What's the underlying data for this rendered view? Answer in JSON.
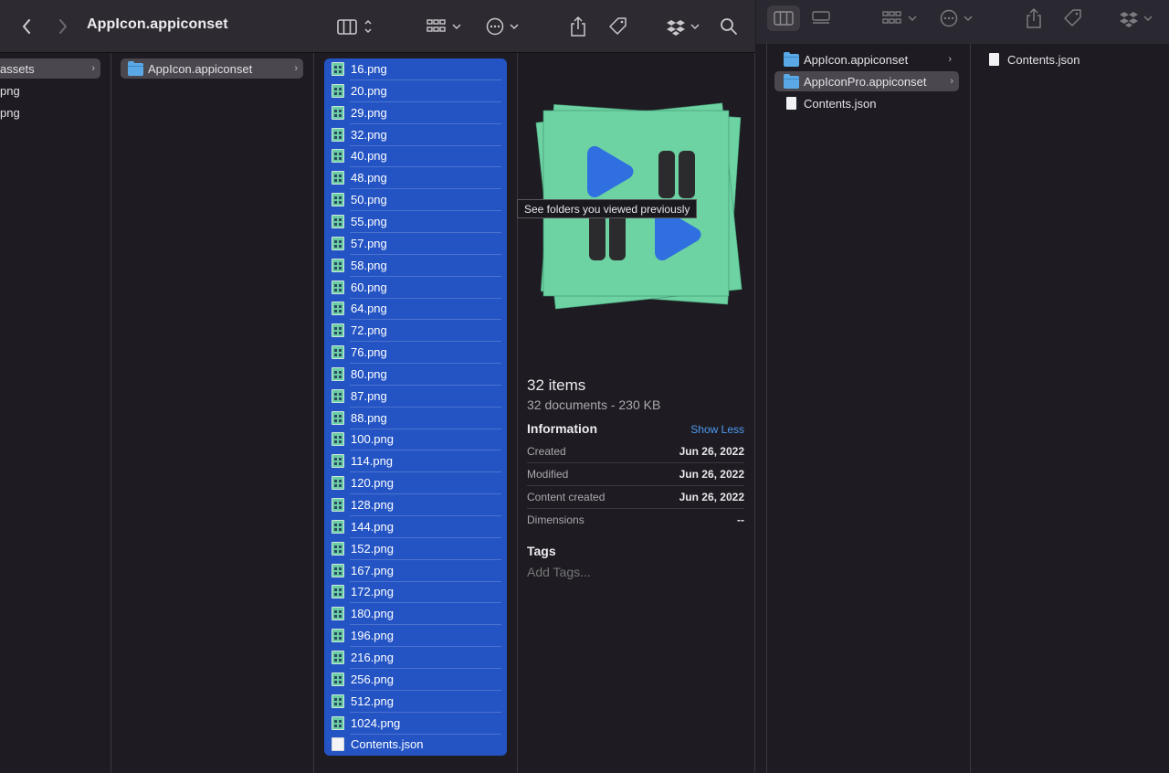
{
  "main_window": {
    "title": "AppIcon.appiconset",
    "toolbar": {
      "back_icon": "chevron-left-icon",
      "forward_icon": "chevron-right-icon",
      "view_icon": "column-view-icon",
      "group_icon": "grid-group-icon",
      "action_icon": "ellipsis-circle-icon",
      "share_icon": "share-icon",
      "tag_icon": "tag-icon",
      "dropbox_icon": "dropbox-icon",
      "search_icon": "search-icon"
    },
    "column1": {
      "items": [
        {
          "label": "assets"
        },
        {
          "label": "png"
        },
        {
          "label": "png"
        }
      ]
    },
    "column2": {
      "items": [
        {
          "label": "AppIcon.appiconset"
        }
      ]
    },
    "column3": {
      "files": [
        "16.png",
        "20.png",
        "29.png",
        "32.png",
        "40.png",
        "48.png",
        "50.png",
        "55.png",
        "57.png",
        "58.png",
        "60.png",
        "64.png",
        "72.png",
        "76.png",
        "80.png",
        "87.png",
        "88.png",
        "100.png",
        "114.png",
        "120.png",
        "128.png",
        "144.png",
        "152.png",
        "167.png",
        "172.png",
        "180.png",
        "196.png",
        "216.png",
        "256.png",
        "512.png",
        "1024.png",
        "Contents.json"
      ]
    },
    "preview": {
      "items_count": "32 items",
      "items_sub": "32 documents - 230 KB",
      "info_heading": "Information",
      "show_less": "Show Less",
      "info": [
        {
          "key": "Created",
          "value": "Jun 26, 2022"
        },
        {
          "key": "Modified",
          "value": "Jun 26, 2022"
        },
        {
          "key": "Content created",
          "value": "Jun 26, 2022"
        },
        {
          "key": "Dimensions",
          "value": "--"
        }
      ],
      "tags_heading": "Tags",
      "tags_placeholder": "Add Tags...",
      "colors": {
        "card": "#6dd3a3",
        "play": "#2f6fe0",
        "pause": "#2b2b2e"
      }
    },
    "tooltip": "See folders you viewed previously"
  },
  "second_window": {
    "column1": {
      "items": [
        {
          "label": "AppIcon.appiconset",
          "type": "folder"
        },
        {
          "label": "AppIconPro.appiconset",
          "type": "folder"
        },
        {
          "label": "Contents.json",
          "type": "document"
        }
      ]
    },
    "column2": {
      "items": [
        {
          "label": "Contents.json",
          "type": "document"
        }
      ]
    }
  },
  "colors": {
    "selection_blue": "#2454c4",
    "selection_gray": "#4a484e",
    "link_blue": "#4c9af2"
  }
}
